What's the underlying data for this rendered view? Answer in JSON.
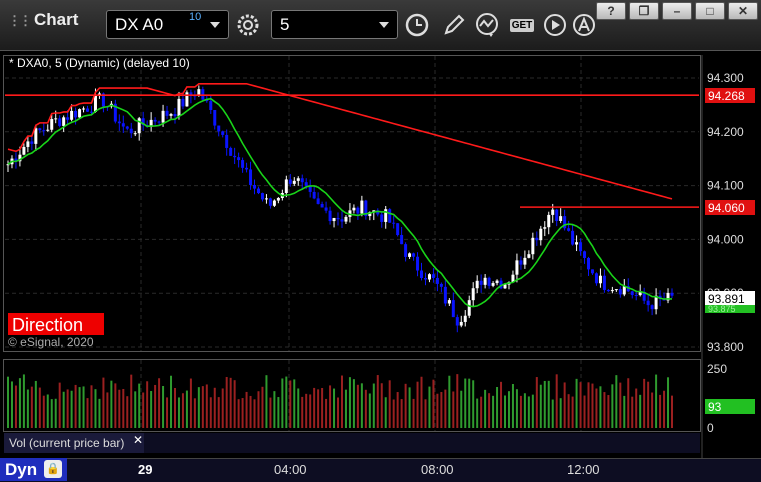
{
  "app": {
    "title": "Chart"
  },
  "toolbar": {
    "symbol": "DX A0",
    "delay_badge": "10",
    "interval": "5",
    "get_label": "GET"
  },
  "window_controls": {
    "help": "?",
    "restore": "❐",
    "minimize": "–",
    "maximize": "□",
    "close": "✕"
  },
  "chart": {
    "study_label": "* DXA0, 5 (Dynamic) (delayed 10)",
    "direction_label": "Direction",
    "copyright": "© eSignal, 2020",
    "price_ticks": [
      "94.300",
      "94.200",
      "94.100",
      "94.000",
      "93.900",
      "93.800"
    ],
    "price_tags": {
      "upper": "94.268",
      "middle": "94.060",
      "last": "93.891",
      "last_sub": "93.875"
    },
    "volume_ticks": [
      "250",
      "100",
      "0"
    ],
    "volume_tag": "93",
    "volume_label": "Vol (current price bar)",
    "time_labels": [
      "29",
      "04:00",
      "08:00",
      "12:00"
    ],
    "dyn_label": "Dyn",
    "colors": {
      "up_candle": "#ffffff",
      "down_candle": "#0a14ff",
      "red_line": "#ff1a1a",
      "green_line": "#19d419",
      "tag_red": "#e01010",
      "tag_green": "#22c022",
      "vol_up": "#2f9b2f",
      "vol_down": "#9b2020"
    }
  },
  "chart_data": {
    "type": "line",
    "title": "* DXA0, 5 (Dynamic) (delayed 10)",
    "x": [
      "29",
      "04:00",
      "08:00",
      "12:00"
    ],
    "series": [
      {
        "name": "DX A0",
        "values": [
          94.14,
          94.19,
          94.22,
          94.24,
          94.26,
          94.2,
          94.22,
          94.24,
          94.28,
          94.2,
          94.12,
          94.06,
          94.12,
          94.06,
          94.04,
          94.06,
          94.04,
          93.96,
          93.92,
          93.85,
          93.93,
          93.92,
          93.99,
          94.06,
          93.98,
          93.92,
          93.91,
          93.88,
          93.89
        ]
      }
    ],
    "ylim": [
      93.78,
      94.33
    ],
    "volume_ylim": [
      0,
      250
    ]
  }
}
